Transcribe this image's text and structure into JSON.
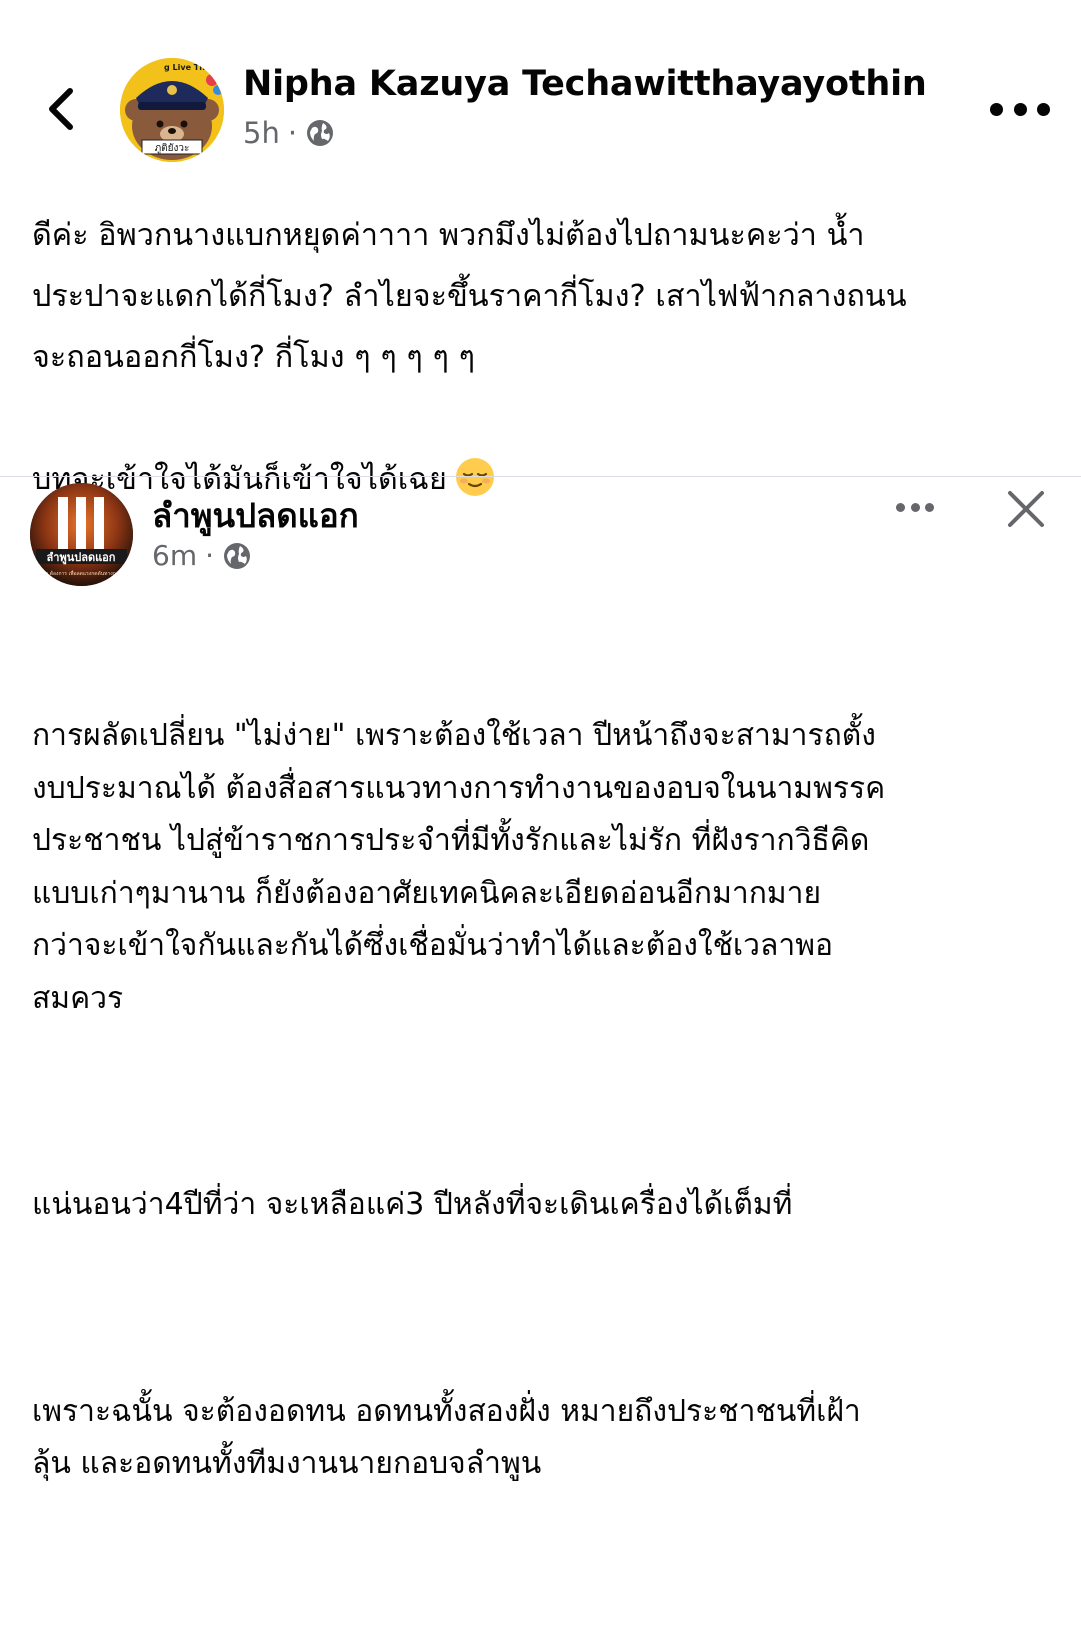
{
  "post": {
    "author_name": "Nipha Kazuya Techawitthayayothin",
    "timestamp": "5h",
    "separator": "·",
    "privacy_icon": "globe-icon",
    "avatar_top_text": "g Live The K",
    "avatar_banner_text": "ภูติยังวะ",
    "text_lines": [
      "ดีค่ะ อิพวกนางแบกหยุดค่าาาา พวกมึงไม่ต้องไปถามนะคะว่า น้ำ",
      "ประปาจะแดกได้กี่โมง? ลำไยจะขึ้นราคากี่โมง? เสาไฟฟ้ากลางถนน",
      "จะถอนออกกี่โมง? กี่โมง ๆ ๆ ๆ ๆ ๆ",
      "",
      "บทจะเข้าใจได้มันก็เข้าใจได้เฉย"
    ],
    "emoji": "relieved-face-emoji"
  },
  "shared": {
    "author_name": "ลำพูนปลดแอก",
    "timestamp": "6m",
    "separator": "·",
    "privacy_icon": "globe-icon",
    "avatar_text": "ลำพูนปลดแอก",
    "avatar_subtext": "ส.ว.ต้องการ เพื่อลดแรงกดดันทางการ",
    "paragraphs": [
      "การผลัดเปลี่ยน \"ไม่ง่าย\" เพราะต้องใช้เวลา ปีหน้าถึงจะสามารถตั้ง\nงบประมาณได้ ต้องสื่อสารแนวทางการทำงานของอบจในนามพรรค\nประชาชน ไปสู่ข้าราชการประจำที่มีทั้งรักและไม่รัก ที่ฝังรากวิธีคิด\nแบบเก่าๆมานาน ก็ยังต้องอาศัยเทคนิคละเอียดอ่อนอีกมากมาย\nกว่าจะเข้าใจกันและกันได้ซึ่งเชื่อมั่นว่าทำได้และต้องใช้เวลาพอ\nสมควร",
      "แน่นอนว่า4ปีที่ว่า จะเหลือแค่3 ปีหลังที่จะเดินเครื่องได้เต็มที่",
      "เพราะฉนั้น จะต้องอดทน อดทนทั้งสองฝั่ง หมายถึงประชาชนที่เฝ้า\nลุ้น และอดทนทั้งทีมงานนายกอบจลำพูน"
    ]
  },
  "icons": {
    "back": "chevron-left-icon",
    "more": "more-horizontal-icon",
    "close": "close-icon"
  },
  "colors": {
    "text": "#050505",
    "secondary": "#65676b",
    "divider": "#dadde1",
    "avatar_yellow": "#f2c21a"
  }
}
